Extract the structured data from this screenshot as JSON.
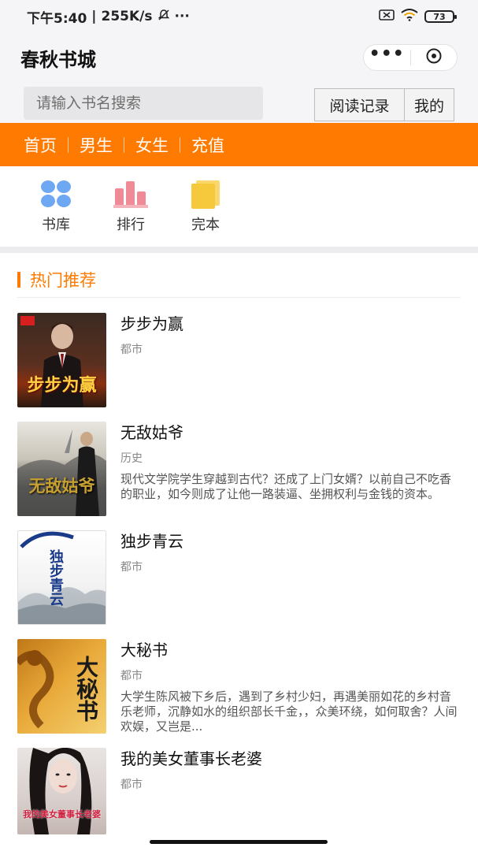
{
  "status_bar": {
    "time": "下午5:40",
    "speed": "255K/s",
    "mute_icon": "bell-off-icon",
    "more": "···",
    "battery": "73"
  },
  "header": {
    "title": "春秋书城",
    "more_icon": "more-dots-icon",
    "close_icon": "close-circle-icon"
  },
  "search": {
    "placeholder": "请输入书名搜索",
    "history_label": "阅读记录",
    "mine_label": "我的"
  },
  "nav": {
    "items": [
      "首页",
      "男生",
      "女生",
      "充值"
    ]
  },
  "quick_entries": [
    {
      "label": "书库",
      "icon": "grid-dots-icon"
    },
    {
      "label": "排行",
      "icon": "bar-chart-icon"
    },
    {
      "label": "完本",
      "icon": "book-stack-icon"
    }
  ],
  "section": {
    "title": "热门推荐"
  },
  "books": [
    {
      "title": "步步为赢",
      "category": "都市",
      "desc": "",
      "cover_text": "步步为赢"
    },
    {
      "title": "无敌姑爷",
      "category": "历史",
      "desc": "现代文学院学生穿越到古代？还成了上门女婿？以前自己不吃香的职业，如今则成了让他一路装逼、坐拥权利与金钱的资本。",
      "cover_text": "无敌姑爷"
    },
    {
      "title": "独步青云",
      "category": "都市",
      "desc": "",
      "cover_text": "独步青云"
    },
    {
      "title": "大秘书",
      "category": "都市",
      "desc": "大学生陈风被下乡后，遇到了乡村少妇，再遇美丽如花的乡村音乐老师，沉静如水的组织部长千金，，众美环绕，如何取舍？人间欢娱，又岂是...",
      "cover_text": "大秘书"
    },
    {
      "title": "我的美女董事长老婆",
      "category": "都市",
      "desc": "",
      "cover_text": "我的美女董事长老婆"
    }
  ],
  "colors": {
    "accent": "#ff7a00",
    "page_bg": "#f5f5f7"
  }
}
